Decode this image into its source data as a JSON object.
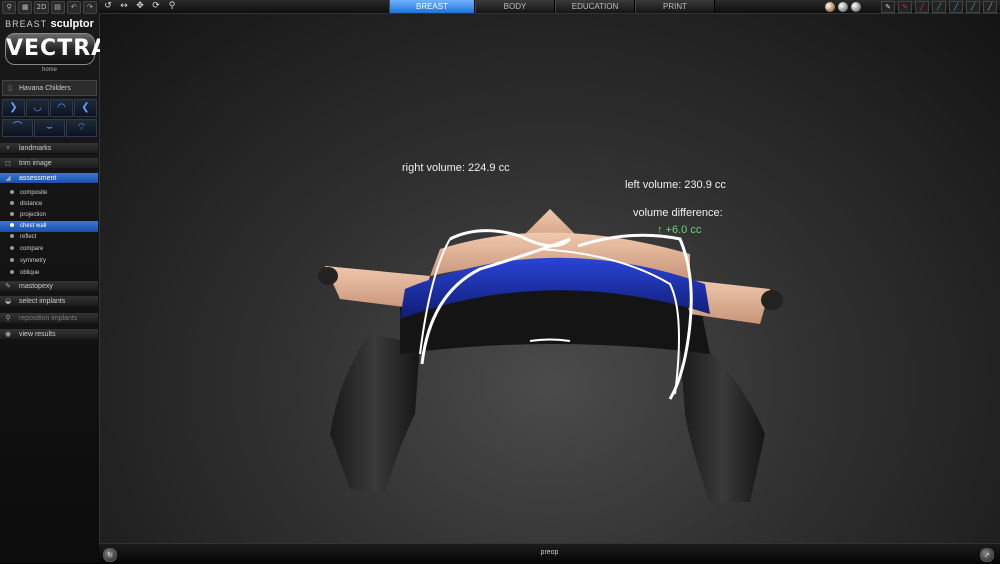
{
  "app": {
    "brand_prefix": "BREAST",
    "brand_suffix": "sculptor",
    "logo": "VECTRA",
    "home": "home"
  },
  "patient": {
    "name": "Havana Childers"
  },
  "tabs": [
    {
      "label": "BREAST",
      "active": true
    },
    {
      "label": "BODY",
      "active": false
    },
    {
      "label": "EDUCATION",
      "active": false
    },
    {
      "label": "PRINT",
      "active": false
    }
  ],
  "sidebar": {
    "items": [
      {
        "label": "landmarks",
        "icon": "landmarks-icon"
      },
      {
        "label": "trim image",
        "icon": "trim-icon"
      },
      {
        "label": "assessment",
        "icon": "assessment-icon",
        "active": true
      }
    ],
    "sub_items": [
      {
        "label": "composite"
      },
      {
        "label": "distance"
      },
      {
        "label": "projection"
      },
      {
        "label": "chest wall",
        "active": true
      },
      {
        "label": "reflect"
      },
      {
        "label": "compare"
      },
      {
        "label": "symmetry"
      },
      {
        "label": "oblique"
      }
    ],
    "lower_items": [
      {
        "label": "mastopexy",
        "icon": "mastopexy-icon"
      },
      {
        "label": "select implants",
        "icon": "implant-icon"
      },
      {
        "label": "reposition implants",
        "icon": "reposition-icon",
        "dim": true
      },
      {
        "label": "view results",
        "icon": "view-results-icon"
      }
    ]
  },
  "measurements": {
    "right_volume": "right volume: 224.9 cc",
    "left_volume": "left volume: 230.9 cc",
    "difference_label": "volume difference:",
    "difference_value": "↑ +6.0 cc"
  },
  "bottom": {
    "label": "preop"
  },
  "colors": {
    "accent": "#1f72d8",
    "difference": "#6fd66f",
    "garment": "#1b2fb0",
    "skin": "#e8b89a"
  }
}
